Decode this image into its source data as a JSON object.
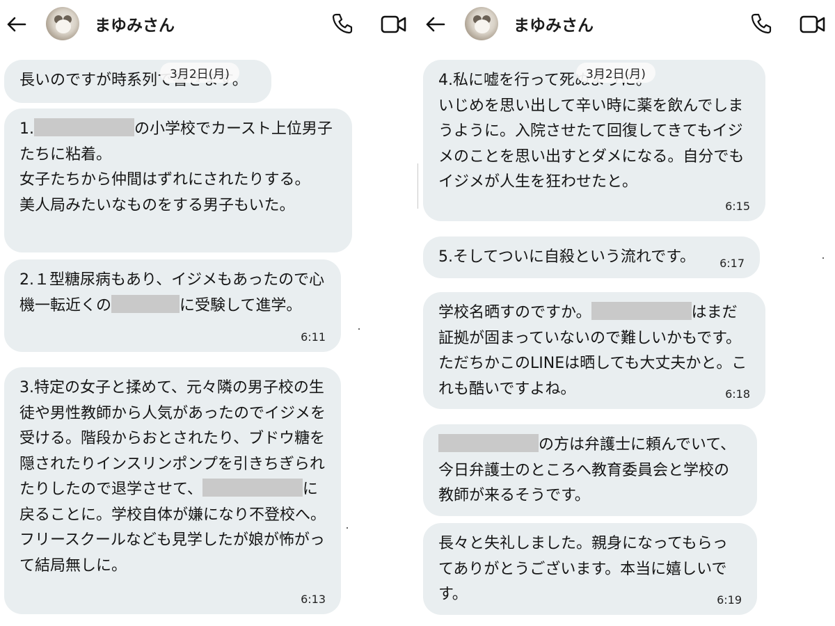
{
  "left": {
    "contact_name": "まゆみさん",
    "date_label": "3月2日(月)",
    "messages": [
      {
        "text": "長いのですが時系列で書きます。",
        "time": ""
      },
      {
        "parts": [
          "1.",
          "の小学校でカースト上位男子たちに粘着。\n女子たちから仲間はずれにされたりする。\n美人局みたいなものをする男子もいた。"
        ],
        "time": ""
      },
      {
        "parts": [
          "2.１型糖尿病もあり、イジメもあったので心機一転近くの",
          "に受験して進学。"
        ],
        "time": "6:11"
      },
      {
        "parts": [
          "3.特定の女子と揉めて、元々隣の男子校の生徒や男性教師から人気があったのでイジメを受ける。階段からおとされたり、ブドウ糖を隠されたりインスリンポンプを引きちぎられたりしたので退学させて、",
          "に戻ることに。学校自体が嫌になり不登校へ。フリースクールなども見学したが娘が怖がって結局無しに。"
        ],
        "time": "6:13"
      }
    ]
  },
  "right": {
    "contact_name": "まゆみさん",
    "date_label": "3月2日(月)",
    "messages": [
      {
        "text": "4.私に嘘を行って死ぬように。\nいじめを思い出して辛い時に薬を飲んでしまうように。入院させたて回復してきてもイジメのことを思い出すとダメになる。自分でもイジメが人生を狂わせたと。",
        "time": "6:15"
      },
      {
        "text": "5.そしてついに自殺という流れです。",
        "time": "6:17"
      },
      {
        "parts": [
          "学校名晒すのですか。",
          "はまだ証拠が固まっていないので難しいかもです。ただちかこのLINEは晒しても大丈夫かと。これも酷いですよね。"
        ],
        "time": "6:18"
      },
      {
        "parts": [
          "",
          "の方は弁護士に頼んでいて、今日弁護士のところへ教育委員会と学校の教師が来るそうです。"
        ],
        "time": ""
      },
      {
        "text": "長々と失礼しました。親身になってもらってありがとうございます。本当に嬉しいです。",
        "time": "6:19"
      }
    ]
  },
  "icons": {
    "back": "arrow-left-icon",
    "phone": "phone-icon",
    "video": "video-camera-icon"
  }
}
